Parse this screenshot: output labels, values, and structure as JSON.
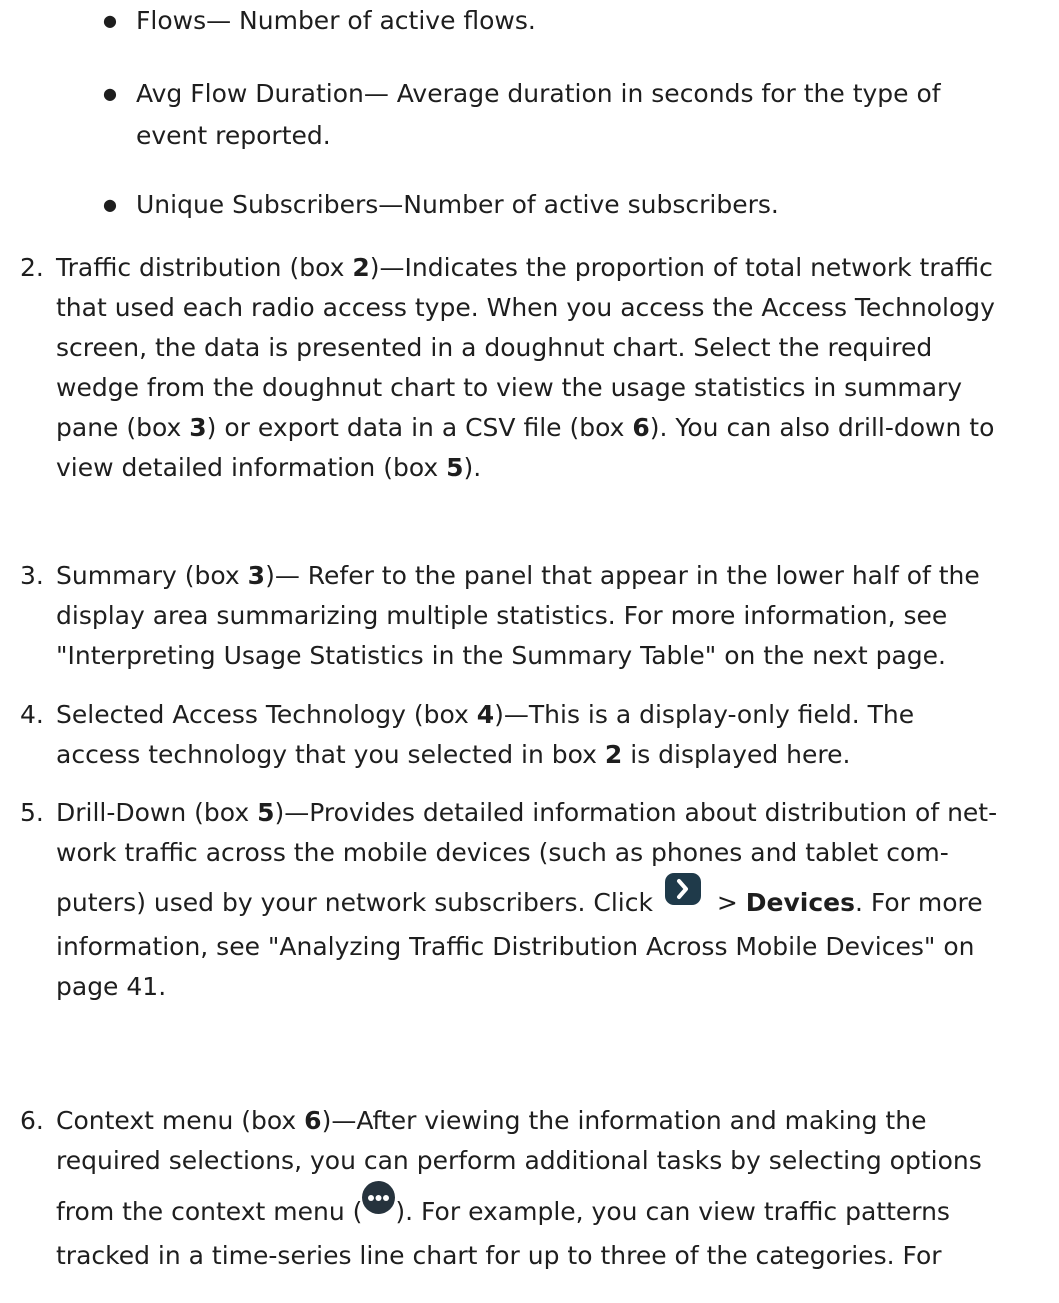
{
  "bullets": [
    "Flows— Number of active flows.",
    "Avg Flow Duration— Average duration in seconds for the type of event reported.",
    "Unique Subscribers—Number of active subscribers."
  ],
  "item2": {
    "num": "2.",
    "lines": [
      [
        "Traffic distribution (box ",
        "2",
        ")—Indicates the proportion of total network traffic"
      ],
      [
        "that used each radio access type. When you access the Access Technology"
      ],
      [
        "screen, the data is presented in a doughnut chart. Select the required"
      ],
      [
        "wedge from the doughnut chart to view the usage statistics in summary"
      ],
      [
        "pane (box ",
        "3",
        ") or export data in a CSV file (box ",
        "6",
        "). You can also drill-down to"
      ],
      [
        "view detailed information (box ",
        "5",
        ")."
      ]
    ]
  },
  "item3": {
    "num": "3.",
    "lines": [
      "Summary (box 3)— Refer to the panel that appear in the lower half of the",
      "display area summarizing multiple statistics. For more information, see",
      "\"Interpreting Usage Statistics in the Summary Table\" on the next page."
    ],
    "bold3": "3"
  },
  "item4": {
    "num": "4.",
    "line1a": "Selected Access Technology (box ",
    "line1b": "4",
    "line1c": ")—This is a display-only field. The",
    "line2a": "access technology that you selected in box ",
    "line2b": "2",
    "line2c": " is displayed here."
  },
  "item5": {
    "num": "5.",
    "line1a": "Drill-Down (box ",
    "line1b": "5",
    "line1c": ")—Provides detailed information about distribution of net-",
    "line2": "work traffic across the mobile devices (such as phones and tablet com-",
    "line3a": "puters) used by your network subscribers. Click ",
    "line3b": " > ",
    "line3c": "Devices",
    "line3d": ". For more",
    "line4": "information, see \"Analyzing Traffic Distribution Across Mobile Devices\" on",
    "line5": "page 41."
  },
  "item6": {
    "num": "6.",
    "line1a": "Context menu (box ",
    "line1b": "6",
    "line1c": ")—After viewing the information and making the",
    "line2": "required selections, you can perform additional tasks by selecting options",
    "line3a": "from the context menu (",
    "line3b": "). For example, you can view traffic patterns",
    "line4": "tracked in a time-series line chart for up to three of the categories. For"
  },
  "colors": {
    "text": "#1e1e1e",
    "icon_bg": "#1f3a4a",
    "menu_icon_bg": "#26333d"
  },
  "icons": {
    "drilldown": "chevron-right-icon",
    "context_menu": "more-dots-icon"
  }
}
